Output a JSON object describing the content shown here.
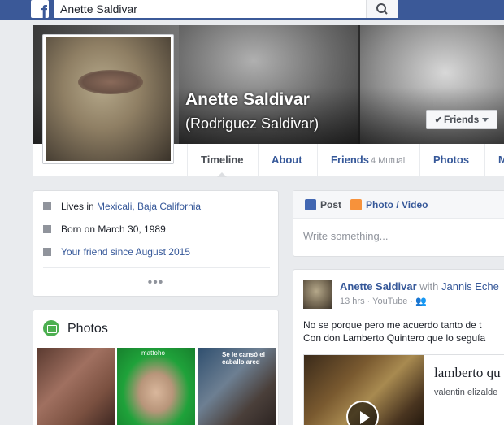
{
  "topbar": {
    "logo": "f",
    "search_value": "Anette Saldivar",
    "search_icon": "magnifier-icon"
  },
  "profile": {
    "name": "Anette Saldivar",
    "alternate_name": "(Rodriguez Saldivar)",
    "friends_button": "Friends"
  },
  "nav": {
    "tabs": [
      {
        "label": "Timeline",
        "active": true
      },
      {
        "label": "About"
      },
      {
        "label": "Friends",
        "extra": "4 Mutual"
      },
      {
        "label": "Photos"
      },
      {
        "label": "M"
      }
    ]
  },
  "intro": {
    "lives_prefix": "Lives in ",
    "lives_place": "Mexicali, Baja California",
    "born": "Born on March 30, 1989",
    "friend_since": "Your friend since August 2015",
    "more": "•••"
  },
  "photos": {
    "title": "Photos",
    "thumb2_caption": "mattoho",
    "thumb3_caption": "Se le cansó el caballo ared"
  },
  "composer": {
    "post_tab": "Post",
    "photo_tab": "Photo / Video",
    "placeholder": "Write something..."
  },
  "post": {
    "author": "Anette Saldivar",
    "with_prefix": " with ",
    "with_name": "Jannis Eche",
    "time": "13 hrs",
    "source": "YouTube",
    "text_line1": "No se porque pero me acuerdo tanto de t",
    "text_line2": "Con don Lamberto Quintero que lo seguía",
    "link_title": "lamberto qu",
    "link_subtitle": "valentin elizalde"
  },
  "colors": {
    "topbar": "#3b5998",
    "link": "#365899",
    "page_bg": "#e9ebee"
  }
}
